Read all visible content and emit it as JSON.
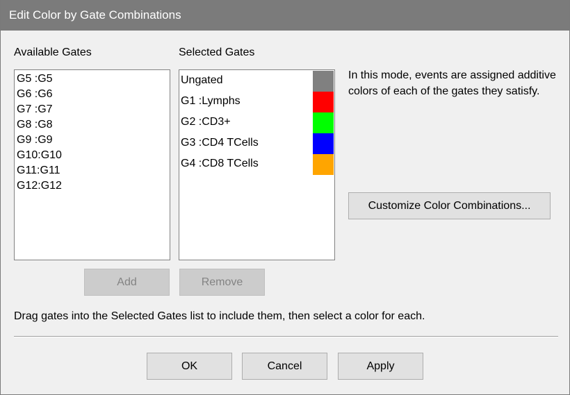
{
  "window": {
    "title": "Edit Color by Gate Combinations"
  },
  "available": {
    "label": "Available Gates",
    "items": [
      "G5 :G5",
      "G6 :G6",
      "G7 :G7",
      "G8 :G8",
      "G9 :G9",
      "G10:G10",
      "G11:G11",
      "G12:G12"
    ],
    "add_label": "Add"
  },
  "selected": {
    "label": "Selected Gates",
    "items": [
      {
        "name": "Ungated",
        "color": "#808080"
      },
      {
        "name": "G1 :Lymphs",
        "color": "#ff0000"
      },
      {
        "name": "G2 :CD3+",
        "color": "#00ff00"
      },
      {
        "name": "G3 :CD4 TCells",
        "color": "#0000ff"
      },
      {
        "name": "G4 :CD8 TCells",
        "color": "#ffa500"
      }
    ],
    "remove_label": "Remove"
  },
  "info": {
    "text": "In this mode, events are assigned additive colors of each of the gates they satisfy."
  },
  "customize": {
    "label": "Customize Color Combinations..."
  },
  "hint": {
    "text": "Drag gates into the Selected Gates list to include them, then select a color for each."
  },
  "footer": {
    "ok_label": "OK",
    "cancel_label": "Cancel",
    "apply_label": "Apply"
  }
}
